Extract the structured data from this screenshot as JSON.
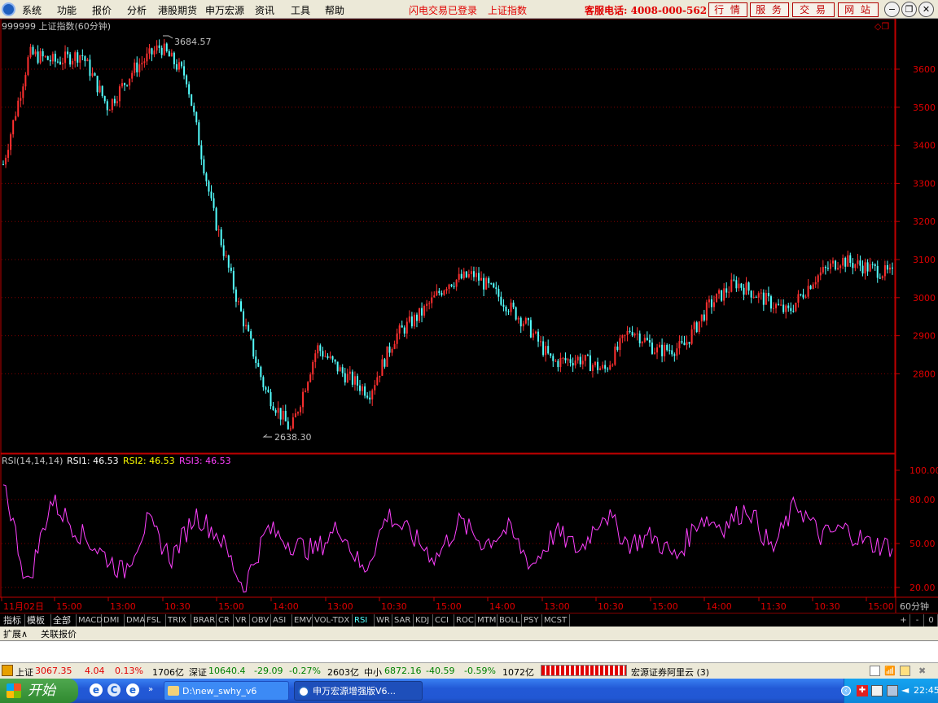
{
  "menu": {
    "items": [
      "系统",
      "功能",
      "报价",
      "分析",
      "港股期货",
      "申万宏源",
      "资讯",
      "工具",
      "帮助"
    ],
    "login": "闪电交易已登录",
    "index_name": "上证指数",
    "hotline": "客服电话: 4008-000-562",
    "nav": [
      "行 情",
      "服 务",
      "交 易",
      "网 站"
    ]
  },
  "chart": {
    "title": "999999 上证指数(60分钟)",
    "high_label": "3684.57",
    "low_label": "2638.30",
    "price_ticks": [
      "3600",
      "3500",
      "3400",
      "3300",
      "3200",
      "3100",
      "3000",
      "2900",
      "2800"
    ],
    "rsi_header": "RSI(14,14,14)",
    "rsi1": "RSI1: 46.53",
    "rsi2": "RSI2: 46.53",
    "rsi3": "RSI3: 46.53",
    "rsi_ticks": [
      "100.00",
      "80.00",
      "50.00",
      "20.00"
    ],
    "time_labels": [
      "11月02日",
      "15:00",
      "13:00",
      "10:30",
      "15:00",
      "14:00",
      "13:00",
      "10:30",
      "15:00",
      "14:00",
      "13:00",
      "10:30",
      "15:00",
      "14:00",
      "11:30",
      "10:30",
      "15:00"
    ],
    "period": "60分钟",
    "colors": {
      "up": "#ff3030",
      "down": "#54ffff",
      "rsi": "#ff40ff",
      "axis": "#c00000",
      "rsi2": "#ffff00"
    }
  },
  "chart_data": {
    "type": "candlestick",
    "period": "60分钟",
    "symbol": "999999",
    "name": "上证指数",
    "x": [
      "11月02日",
      "15:00",
      "13:00",
      "10:30",
      "15:00",
      "14:00",
      "13:00",
      "10:30",
      "15:00",
      "14:00",
      "13:00",
      "10:30",
      "15:00",
      "14:00",
      "11:30",
      "10:30",
      "15:00"
    ],
    "close_approx": [
      3350,
      3640,
      3620,
      3640,
      3500,
      3600,
      3660,
      3580,
      3230,
      2980,
      2760,
      2650,
      2870,
      2800,
      2750,
      2900,
      2960,
      3040,
      3060,
      3000,
      2930,
      2830,
      2840,
      2810,
      2920,
      2860,
      2870,
      2980,
      3040,
      3000,
      2960,
      3050,
      3100,
      3080,
      3060
    ],
    "price_ylim": [
      2638.3,
      3684.57
    ],
    "highest": 3684.57,
    "lowest": 2638.3,
    "rsi_ylim": [
      0,
      100
    ],
    "rsi_last": 46.53,
    "rsi_approx": [
      95,
      20,
      80,
      60,
      45,
      30,
      65,
      40,
      70,
      55,
      20,
      60,
      50,
      45,
      62,
      30,
      70,
      55,
      40,
      65,
      50,
      60,
      35,
      58,
      45,
      72,
      50,
      55,
      40,
      68,
      62,
      75,
      45,
      78,
      55,
      60,
      50,
      48
    ]
  },
  "tabs": [
    "指标",
    "模板",
    "全部",
    "MACD",
    "DMI",
    "DMA",
    "FSL",
    "TRIX",
    "BRAR",
    "CR",
    "VR",
    "OBV",
    "ASI",
    "EMV",
    "VOL-TDX",
    "RSI",
    "WR",
    "SAR",
    "KDJ",
    "CCI",
    "ROC",
    "MTM",
    "BOLL",
    "PSY",
    "MCST"
  ],
  "tab_right": [
    "+",
    "-",
    "0"
  ],
  "ext": [
    "扩展∧",
    "关联报价"
  ],
  "status": {
    "sh_name": "上证",
    "sh_val": "3067.35",
    "sh_chg": "4.04",
    "sh_pct": "0.13%",
    "sh_amt": "1706亿",
    "sz_name": "深证",
    "sz_val": "10640.4",
    "sz_chg": "-29.09",
    "sz_pct": "-0.27%",
    "sz_amt": "2603亿",
    "zx_name": "中小",
    "zx_val": "6872.16",
    "zx_chg": "-40.59",
    "zx_pct": "-0.59%",
    "zx_amt": "1072亿",
    "broker": "宏源证券阿里云 (3)"
  },
  "taskbar": {
    "start": "开始",
    "task1": "D:\\new_swhy_v6",
    "task2": "申万宏源增强版V6...",
    "clock": "22:45"
  }
}
